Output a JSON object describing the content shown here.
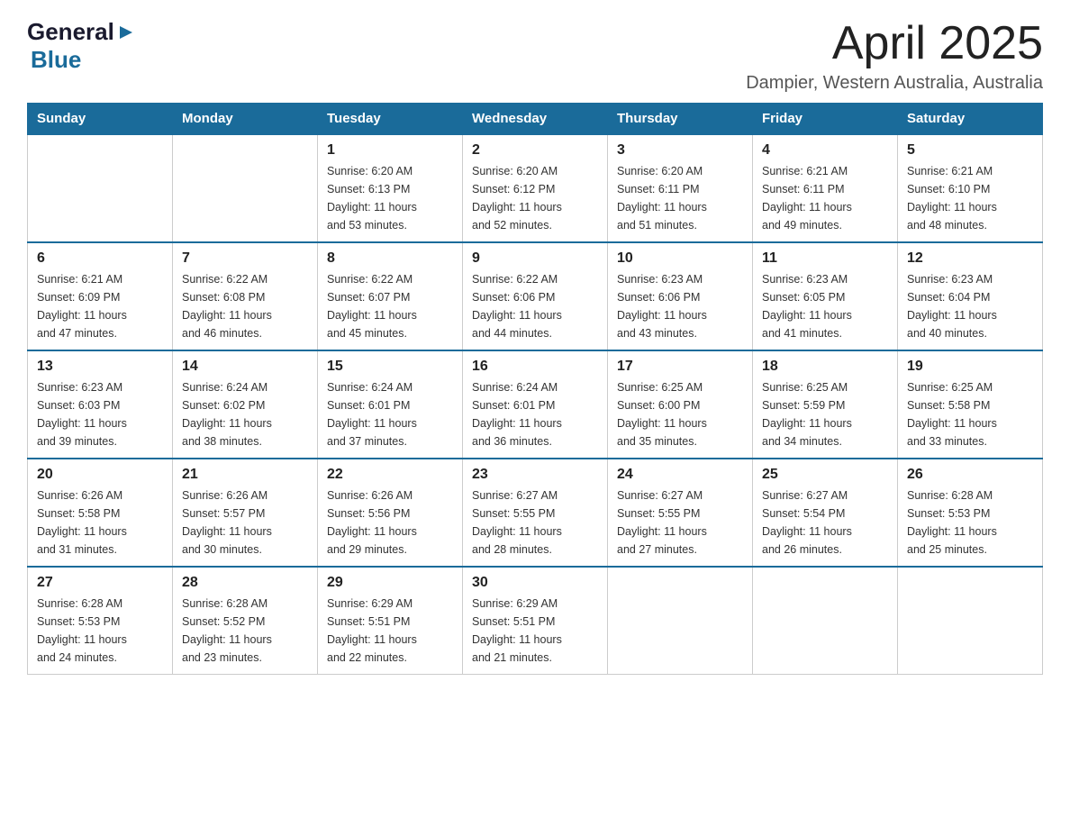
{
  "logo": {
    "general": "General",
    "arrow": "",
    "blue": "Blue"
  },
  "header": {
    "title": "April 2025",
    "subtitle": "Dampier, Western Australia, Australia"
  },
  "calendar": {
    "columns": [
      "Sunday",
      "Monday",
      "Tuesday",
      "Wednesday",
      "Thursday",
      "Friday",
      "Saturday"
    ],
    "rows": [
      [
        {
          "day": "",
          "info": ""
        },
        {
          "day": "",
          "info": ""
        },
        {
          "day": "1",
          "info": "Sunrise: 6:20 AM\nSunset: 6:13 PM\nDaylight: 11 hours\nand 53 minutes."
        },
        {
          "day": "2",
          "info": "Sunrise: 6:20 AM\nSunset: 6:12 PM\nDaylight: 11 hours\nand 52 minutes."
        },
        {
          "day": "3",
          "info": "Sunrise: 6:20 AM\nSunset: 6:11 PM\nDaylight: 11 hours\nand 51 minutes."
        },
        {
          "day": "4",
          "info": "Sunrise: 6:21 AM\nSunset: 6:11 PM\nDaylight: 11 hours\nand 49 minutes."
        },
        {
          "day": "5",
          "info": "Sunrise: 6:21 AM\nSunset: 6:10 PM\nDaylight: 11 hours\nand 48 minutes."
        }
      ],
      [
        {
          "day": "6",
          "info": "Sunrise: 6:21 AM\nSunset: 6:09 PM\nDaylight: 11 hours\nand 47 minutes."
        },
        {
          "day": "7",
          "info": "Sunrise: 6:22 AM\nSunset: 6:08 PM\nDaylight: 11 hours\nand 46 minutes."
        },
        {
          "day": "8",
          "info": "Sunrise: 6:22 AM\nSunset: 6:07 PM\nDaylight: 11 hours\nand 45 minutes."
        },
        {
          "day": "9",
          "info": "Sunrise: 6:22 AM\nSunset: 6:06 PM\nDaylight: 11 hours\nand 44 minutes."
        },
        {
          "day": "10",
          "info": "Sunrise: 6:23 AM\nSunset: 6:06 PM\nDaylight: 11 hours\nand 43 minutes."
        },
        {
          "day": "11",
          "info": "Sunrise: 6:23 AM\nSunset: 6:05 PM\nDaylight: 11 hours\nand 41 minutes."
        },
        {
          "day": "12",
          "info": "Sunrise: 6:23 AM\nSunset: 6:04 PM\nDaylight: 11 hours\nand 40 minutes."
        }
      ],
      [
        {
          "day": "13",
          "info": "Sunrise: 6:23 AM\nSunset: 6:03 PM\nDaylight: 11 hours\nand 39 minutes."
        },
        {
          "day": "14",
          "info": "Sunrise: 6:24 AM\nSunset: 6:02 PM\nDaylight: 11 hours\nand 38 minutes."
        },
        {
          "day": "15",
          "info": "Sunrise: 6:24 AM\nSunset: 6:01 PM\nDaylight: 11 hours\nand 37 minutes."
        },
        {
          "day": "16",
          "info": "Sunrise: 6:24 AM\nSunset: 6:01 PM\nDaylight: 11 hours\nand 36 minutes."
        },
        {
          "day": "17",
          "info": "Sunrise: 6:25 AM\nSunset: 6:00 PM\nDaylight: 11 hours\nand 35 minutes."
        },
        {
          "day": "18",
          "info": "Sunrise: 6:25 AM\nSunset: 5:59 PM\nDaylight: 11 hours\nand 34 minutes."
        },
        {
          "day": "19",
          "info": "Sunrise: 6:25 AM\nSunset: 5:58 PM\nDaylight: 11 hours\nand 33 minutes."
        }
      ],
      [
        {
          "day": "20",
          "info": "Sunrise: 6:26 AM\nSunset: 5:58 PM\nDaylight: 11 hours\nand 31 minutes."
        },
        {
          "day": "21",
          "info": "Sunrise: 6:26 AM\nSunset: 5:57 PM\nDaylight: 11 hours\nand 30 minutes."
        },
        {
          "day": "22",
          "info": "Sunrise: 6:26 AM\nSunset: 5:56 PM\nDaylight: 11 hours\nand 29 minutes."
        },
        {
          "day": "23",
          "info": "Sunrise: 6:27 AM\nSunset: 5:55 PM\nDaylight: 11 hours\nand 28 minutes."
        },
        {
          "day": "24",
          "info": "Sunrise: 6:27 AM\nSunset: 5:55 PM\nDaylight: 11 hours\nand 27 minutes."
        },
        {
          "day": "25",
          "info": "Sunrise: 6:27 AM\nSunset: 5:54 PM\nDaylight: 11 hours\nand 26 minutes."
        },
        {
          "day": "26",
          "info": "Sunrise: 6:28 AM\nSunset: 5:53 PM\nDaylight: 11 hours\nand 25 minutes."
        }
      ],
      [
        {
          "day": "27",
          "info": "Sunrise: 6:28 AM\nSunset: 5:53 PM\nDaylight: 11 hours\nand 24 minutes."
        },
        {
          "day": "28",
          "info": "Sunrise: 6:28 AM\nSunset: 5:52 PM\nDaylight: 11 hours\nand 23 minutes."
        },
        {
          "day": "29",
          "info": "Sunrise: 6:29 AM\nSunset: 5:51 PM\nDaylight: 11 hours\nand 22 minutes."
        },
        {
          "day": "30",
          "info": "Sunrise: 6:29 AM\nSunset: 5:51 PM\nDaylight: 11 hours\nand 21 minutes."
        },
        {
          "day": "",
          "info": ""
        },
        {
          "day": "",
          "info": ""
        },
        {
          "day": "",
          "info": ""
        }
      ]
    ]
  }
}
